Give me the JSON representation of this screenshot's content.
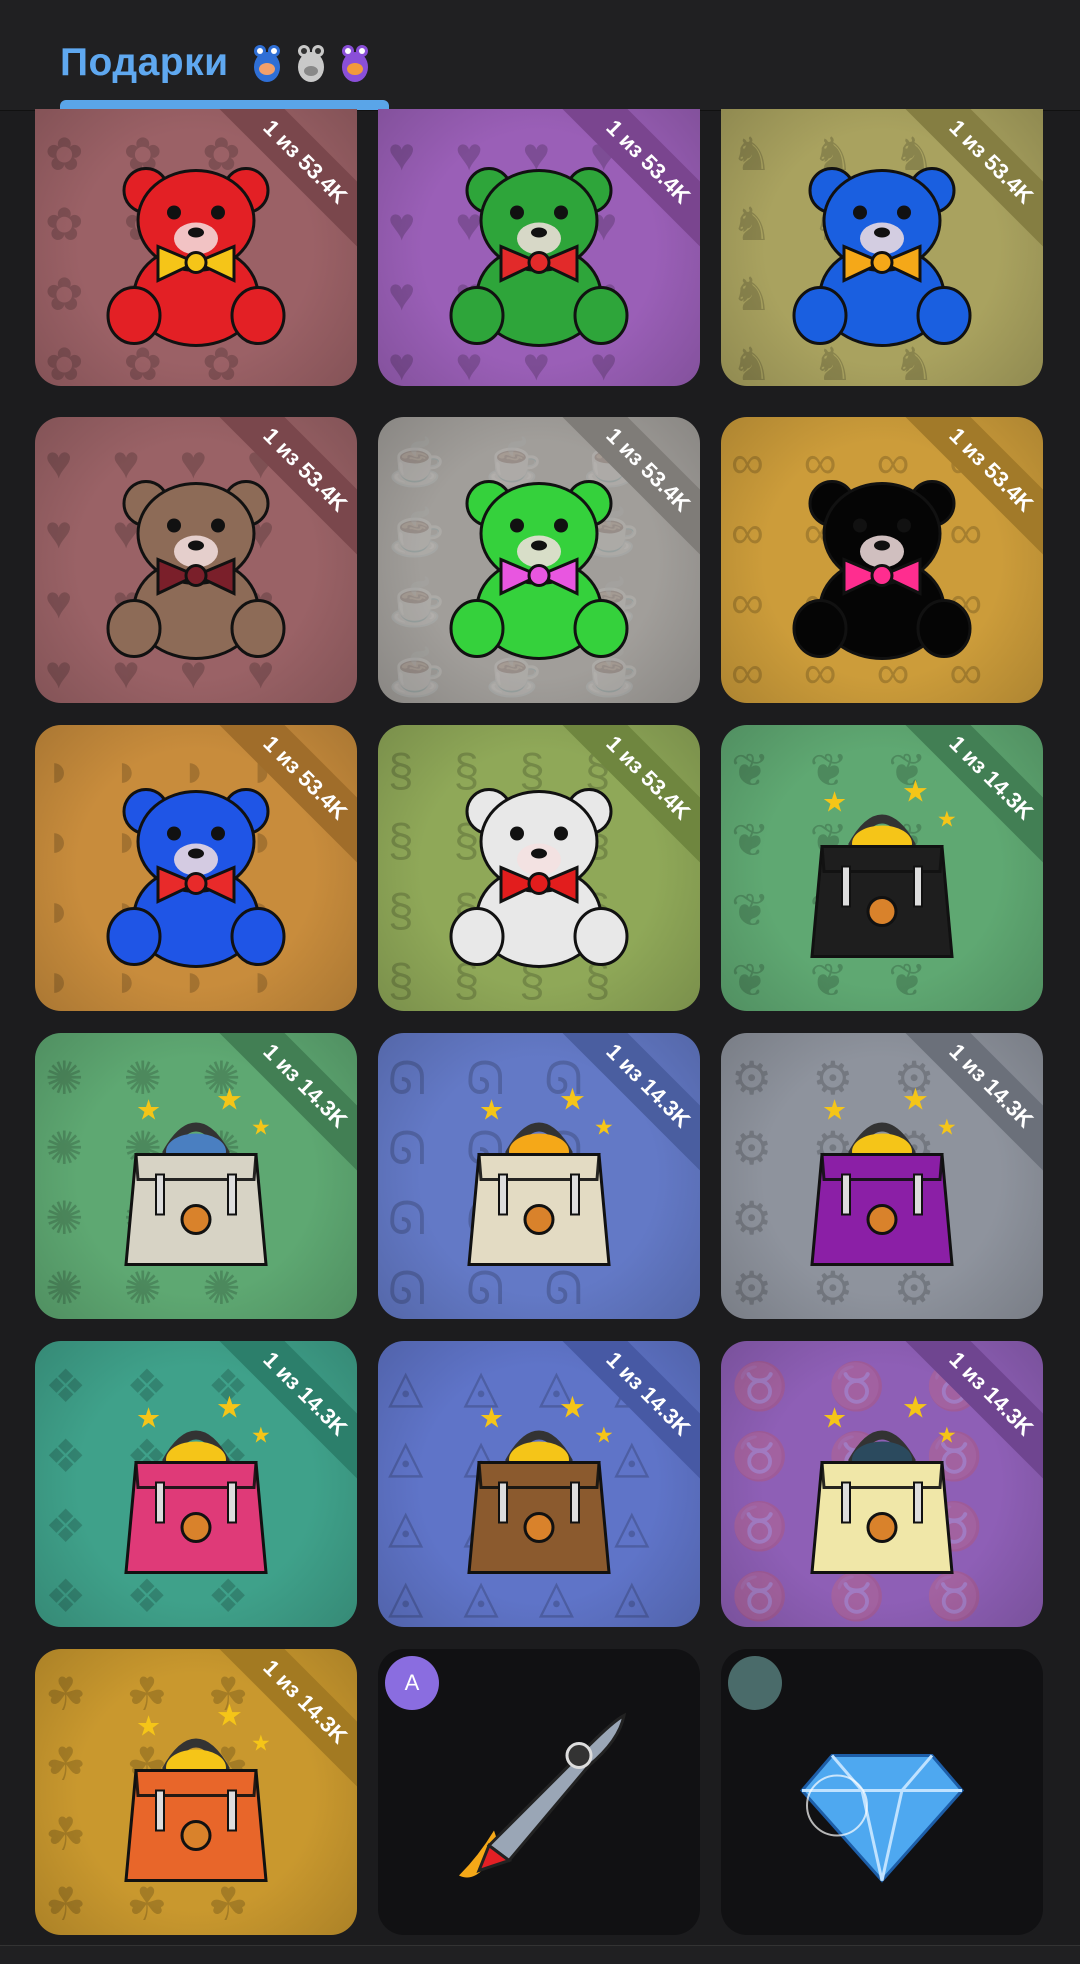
{
  "header": {
    "tab_label": "Подарки",
    "tab_icons": [
      "frog-blue-icon",
      "frog-gray-icon",
      "frog-purple-icon"
    ]
  },
  "cards": [
    {
      "kind": "teddy-bear-red",
      "ribbon": "1 из 53.4K",
      "bg": "#9b6166",
      "ribbon_color": "#7a474c",
      "body": "#e32025",
      "accent": "#f5c518",
      "pattern": "rabbit"
    },
    {
      "kind": "teddy-bear-watermelon",
      "ribbon": "1 из 53.4K",
      "bg": "#9a5fb7",
      "ribbon_color": "#7a458f",
      "body": "#2ea53a",
      "accent": "#e22a2a",
      "pattern": "heart"
    },
    {
      "kind": "teddy-bear-blue",
      "ribbon": "1 из 53.4K",
      "bg": "#a9a25f",
      "ribbon_color": "#857e42",
      "body": "#1a5fe0",
      "accent": "#f5a818",
      "pattern": "horse"
    },
    {
      "kind": "teddy-bear-brown",
      "ribbon": "1 из 53.4K",
      "bg": "#9a6266",
      "ribbon_color": "#7a474c",
      "body": "#8d6b57",
      "accent": "#7a1f2a",
      "pattern": "heart"
    },
    {
      "kind": "teddy-bear-green",
      "ribbon": "1 из 53.4K",
      "bg": "#a19e9a",
      "ribbon_color": "#7f7c78",
      "body": "#35d13c",
      "accent": "#e856e0",
      "pattern": "cup"
    },
    {
      "kind": "teddy-bear-black",
      "ribbon": "1 из 53.4K",
      "bg": "#cc9c3a",
      "ribbon_color": "#a27a29",
      "body": "#050505",
      "accent": "#ff2d8f",
      "pattern": "glasses"
    },
    {
      "kind": "teddy-bear-rainbow",
      "ribbon": "1 из 53.4K",
      "bg": "#c88c3c",
      "ribbon_color": "#a06d2a",
      "body": "#1f55e6",
      "accent": "#e82a2a",
      "pattern": "lips"
    },
    {
      "kind": "teddy-bear-zebra",
      "ribbon": "1 из 53.4K",
      "bg": "#8fa858",
      "ribbon_color": "#6f863f",
      "body": "#e8e8e8",
      "accent": "#e21d1d",
      "pattern": "seahorse"
    },
    {
      "kind": "bag-black",
      "ribbon": "1 из 14.3K",
      "bg": "#5fa872",
      "ribbon_color": "#427f54",
      "body": "#1e1e1e",
      "accent": "#f5c518",
      "pattern": "leaf"
    },
    {
      "kind": "bag-scarf-white",
      "ribbon": "1 из 14.3K",
      "bg": "#5ea872",
      "ribbon_color": "#427f54",
      "body": "#d7d3c5",
      "accent": "#4a7fc1",
      "pattern": "crab"
    },
    {
      "kind": "bag-cream",
      "ribbon": "1 из 14.3K",
      "bg": "#6379c6",
      "ribbon_color": "#4a5ea0",
      "body": "#e3dbc3",
      "accent": "#f5a818",
      "pattern": "chameleon"
    },
    {
      "kind": "bag-purple",
      "ribbon": "1 из 14.3K",
      "bg": "#8e939d",
      "ribbon_color": "#6b707a",
      "body": "#8b1fa6",
      "accent": "#f5c518",
      "pattern": "gear"
    },
    {
      "kind": "bag-pink",
      "ribbon": "1 из 14.3K",
      "bg": "#3fa18a",
      "ribbon_color": "#2c7f6b",
      "body": "#df3a78",
      "accent": "#f5c518",
      "pattern": "wolf"
    },
    {
      "kind": "bag-brown",
      "ribbon": "1 из 14.3K",
      "bg": "#5f74c8",
      "ribbon_color": "#4759a4",
      "body": "#8b5a2e",
      "accent": "#f5c518",
      "pattern": "eye"
    },
    {
      "kind": "bag-yellow",
      "ribbon": "1 из 14.3K",
      "bg": "#8e5fb6",
      "ribbon_color": "#6f4590",
      "body": "#f0e7a8",
      "accent": "#2b4a5e",
      "pattern": "bull"
    },
    {
      "kind": "bag-orange",
      "ribbon": "1 из 14.3K",
      "bg": "#c9982e",
      "ribbon_color": "#a37a22",
      "body": "#e8662a",
      "accent": "#f5c518",
      "pattern": "knot"
    }
  ],
  "extra_cards": [
    {
      "kind": "rocket",
      "avatar_letter": "A",
      "avatar_color": "#8a6de0"
    },
    {
      "kind": "diamond",
      "avatar_letter": "",
      "avatar_color": "#4a6b6a"
    }
  ]
}
